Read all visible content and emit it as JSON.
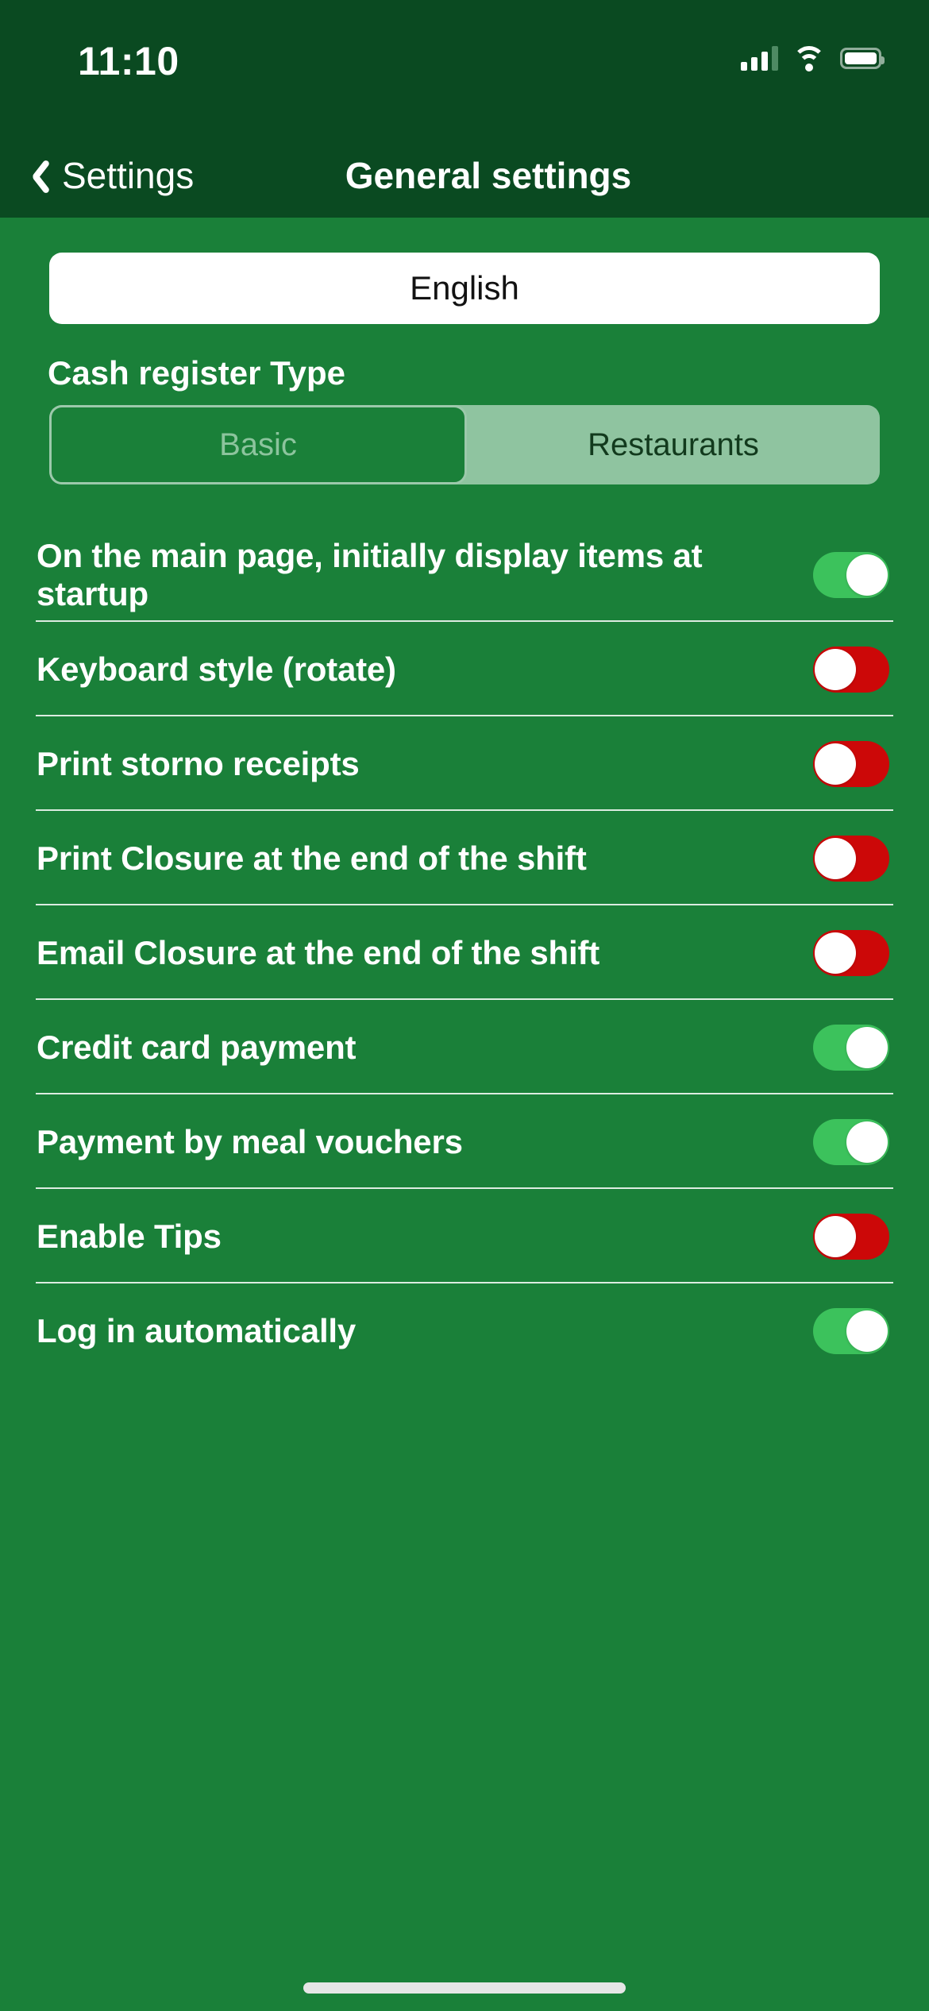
{
  "status_bar": {
    "time": "11:10",
    "icons": {
      "cellular": "signal-bars-icon",
      "wifi": "wifi-icon",
      "battery": "battery-icon"
    }
  },
  "nav": {
    "back_icon": "chevron-left-icon",
    "back_label": "Settings",
    "title": "General settings"
  },
  "language": {
    "selected": "English"
  },
  "cash_register_type": {
    "label": "Cash register Type",
    "options": [
      "Basic",
      "Restaurants"
    ],
    "selected": "Basic"
  },
  "settings_rows": [
    {
      "label": "On the main page, initially display items at startup",
      "state": "on"
    },
    {
      "label": "Keyboard style (rotate)",
      "state": "off"
    },
    {
      "label": "Print storno receipts",
      "state": "off"
    },
    {
      "label": "Print Closure at the end of the shift",
      "state": "off"
    },
    {
      "label": "Email Closure at the end of the shift",
      "state": "off"
    },
    {
      "label": "Credit card payment",
      "state": "on"
    },
    {
      "label": "Payment by meal vouchers",
      "state": "on"
    },
    {
      "label": "Enable Tips",
      "state": "off"
    },
    {
      "label": "Log in automatically",
      "state": "on"
    }
  ],
  "colors": {
    "page_background": "#1a8039",
    "header_background": "#0a4a21",
    "switch_on": "#3cc25c",
    "switch_off": "#cc0808",
    "segment_track": "#8fc4a0",
    "text_primary": "#ffffff",
    "language_button_background": "#ffffff"
  },
  "home_indicator": "home-indicator"
}
